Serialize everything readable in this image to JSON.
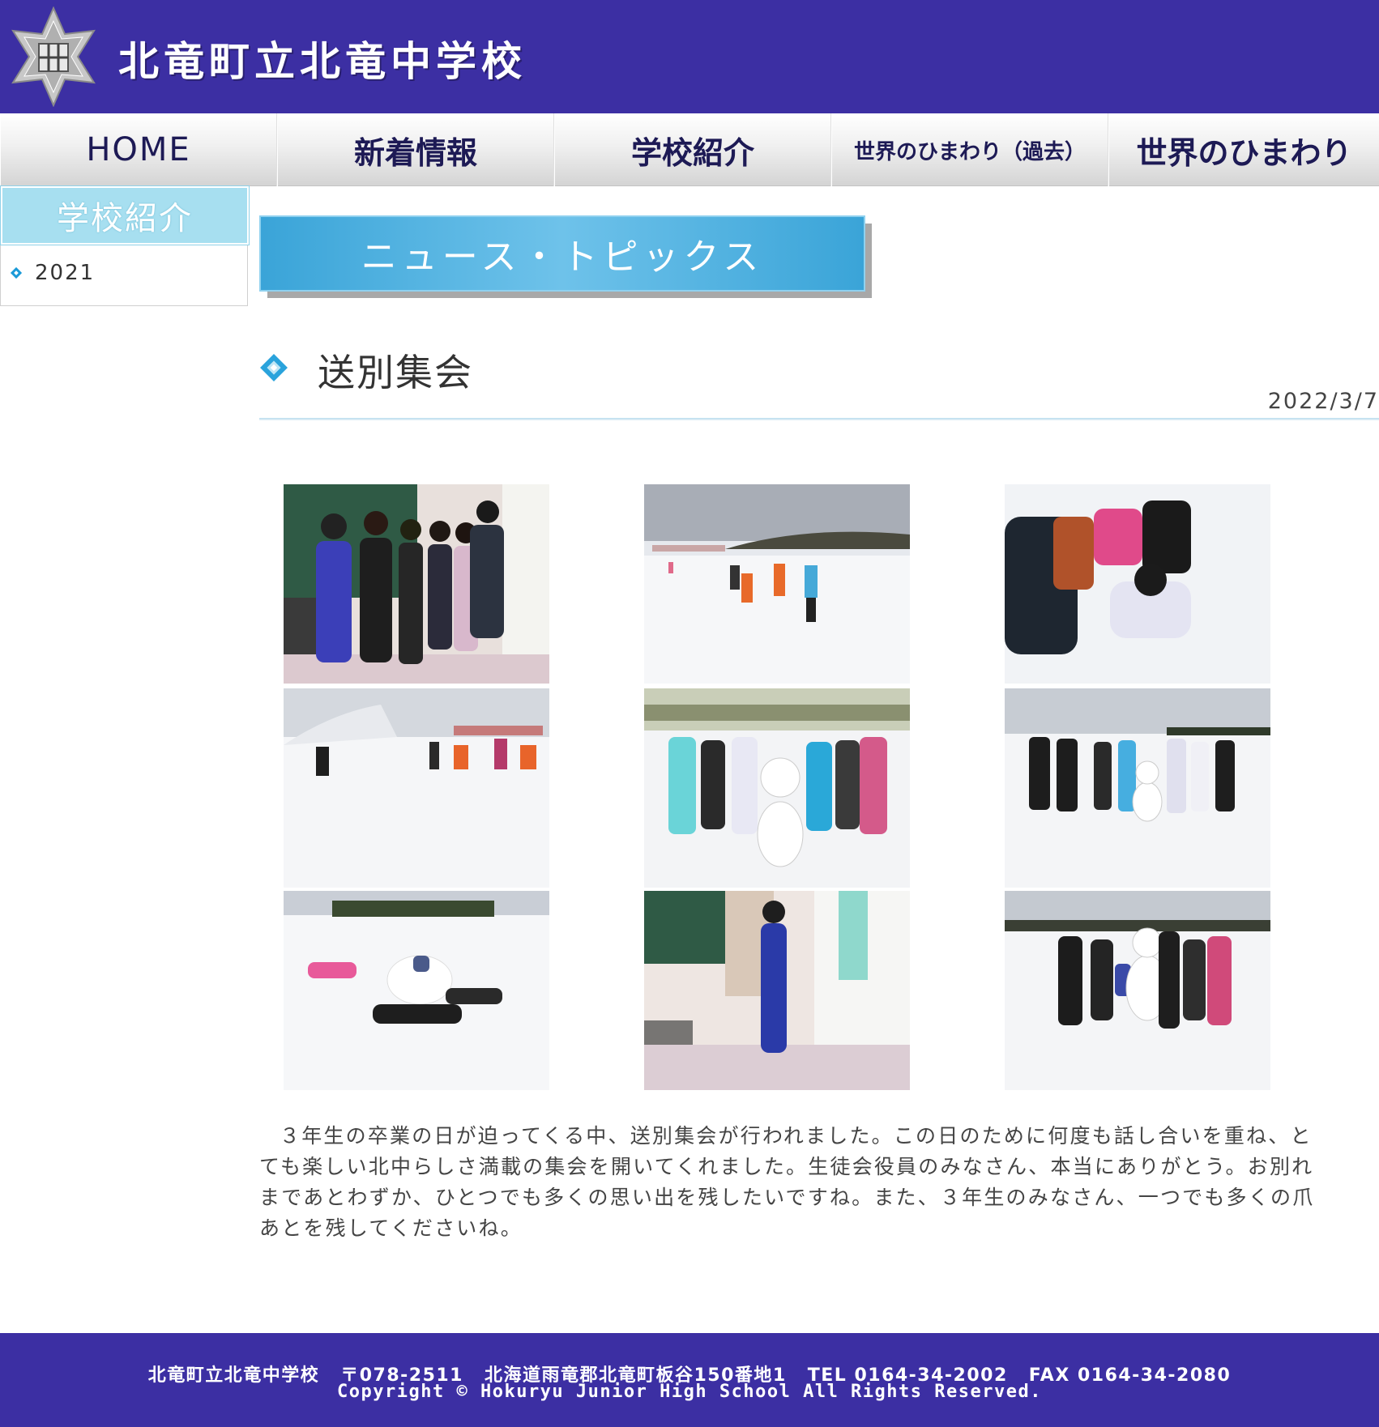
{
  "header": {
    "site_title": "北竜町立北竜中学校",
    "logo_icon": "school-emblem-icon"
  },
  "nav": {
    "items": [
      {
        "label": "HOME"
      },
      {
        "label": "新着情報"
      },
      {
        "label": "学校紹介"
      },
      {
        "label": "世界のひまわり（過去）"
      },
      {
        "label": "世界のひまわり"
      }
    ]
  },
  "sidebar": {
    "heading": "学校紹介",
    "items": [
      {
        "label": "2021"
      }
    ]
  },
  "banner": {
    "label": "ニュース・トピックス"
  },
  "article": {
    "title": "送別集会",
    "date": "2022/3/7",
    "photos": [
      {
        "subject": "classroom-students-photo"
      },
      {
        "subject": "snowfield-game-photo"
      },
      {
        "subject": "snow-digging-photo"
      },
      {
        "subject": "snow-running-photo"
      },
      {
        "subject": "snowman-group-photo"
      },
      {
        "subject": "snowman-line-photo"
      },
      {
        "subject": "lying-in-snow-photo"
      },
      {
        "subject": "classroom-teacher-photo"
      },
      {
        "subject": "snowman-pose-photo"
      }
    ],
    "body": "３年生の卒業の日が迫ってくる中、送別集会が行われました。この日のために何度も話し合いを重ね、とても楽しい北中らしさ満載の集会を開いてくれました。生徒会役員のみなさん、本当にありがとう。お別れまであとわずか、ひとつでも多くの思い出を残したいですね。また、３年生のみなさん、一つでも多くの爪あとを残してくださいね。"
  },
  "footer": {
    "school": "北竜町立北竜中学校",
    "postal": "〒078-2511",
    "address": "北海道雨竜郡北竜町板谷150番地1",
    "tel": "TEL 0164-34-2002",
    "fax": "FAX 0164-34-2080",
    "copyright": "Copyright © Hokuryu Junior High School All Rights Reserved."
  },
  "colors": {
    "header_bg": "#3c2fa3",
    "accent_blue": "#2aa3dc",
    "sidebar_head": "#a7dff0"
  }
}
